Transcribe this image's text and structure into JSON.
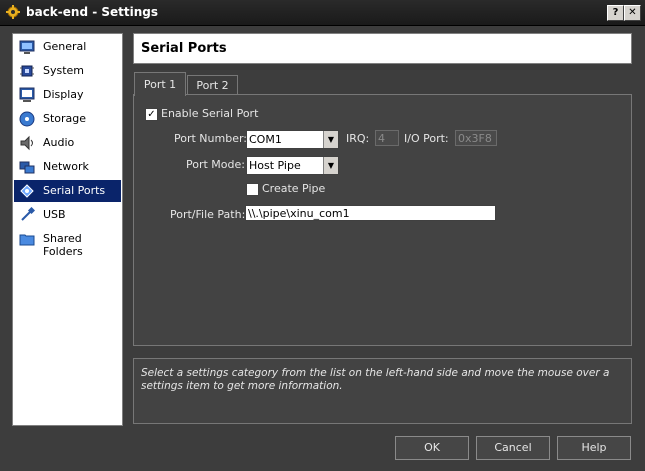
{
  "window": {
    "title": "back-end - Settings",
    "help_glyph": "?",
    "close_glyph": "✕"
  },
  "sidebar": {
    "items": [
      {
        "label": "General",
        "icon": "monitor-icon"
      },
      {
        "label": "System",
        "icon": "chip-icon"
      },
      {
        "label": "Display",
        "icon": "display-icon"
      },
      {
        "label": "Storage",
        "icon": "disk-icon"
      },
      {
        "label": "Audio",
        "icon": "speaker-icon"
      },
      {
        "label": "Network",
        "icon": "network-icon"
      },
      {
        "label": "Serial Ports",
        "icon": "serial-port-icon",
        "selected": true
      },
      {
        "label": "USB",
        "icon": "usb-icon"
      },
      {
        "label": "Shared Folders",
        "icon": "folder-icon"
      }
    ]
  },
  "page": {
    "title": "Serial Ports"
  },
  "tabs": [
    {
      "label": "Port 1",
      "active": true
    },
    {
      "label": "Port 2"
    }
  ],
  "port": {
    "enable_label": "Enable Serial Port",
    "enable_checked": true,
    "enable_mark": "✓",
    "port_number_label": "Port Number:",
    "port_number_value": "COM1",
    "irq_label": "IRQ:",
    "irq_value": "4",
    "io_port_label": "I/O Port:",
    "io_port_value": "0x3F8",
    "port_mode_label": "Port Mode:",
    "port_mode_value": "Host Pipe",
    "create_pipe_label": "Create Pipe",
    "create_pipe_checked": false,
    "path_label": "Port/File Path:",
    "path_value": "\\\\.\\pipe\\xinu_com1"
  },
  "info": {
    "text": "Select a settings category from the list on the left-hand side and move the mouse over a settings item to get more information."
  },
  "buttons": {
    "ok": "OK",
    "cancel": "Cancel",
    "help": "Help"
  },
  "colors": {
    "selection": "#0a246a",
    "background": "#3d3d3d",
    "panel": "#434343"
  }
}
